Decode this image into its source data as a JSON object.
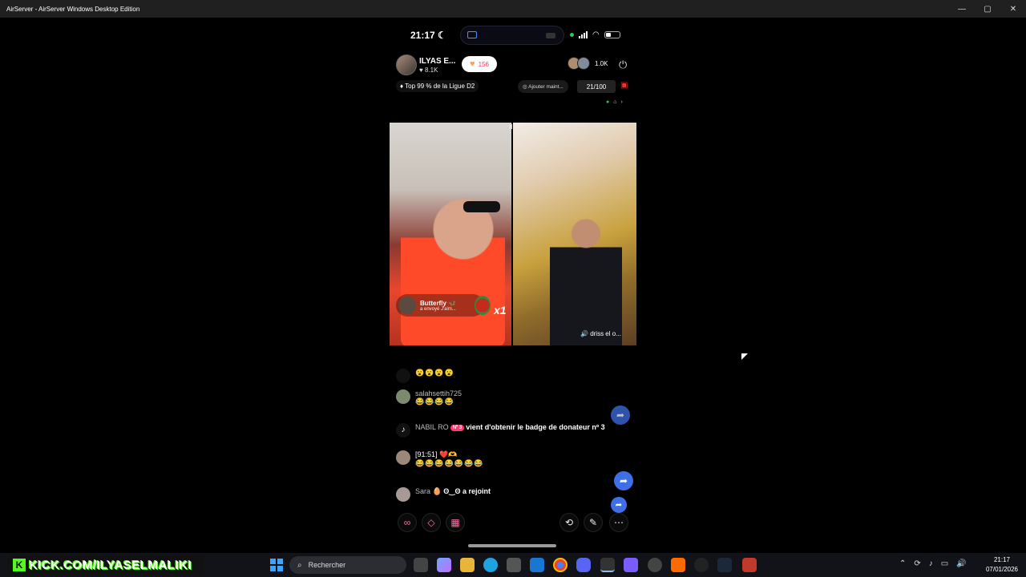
{
  "window": {
    "title": "AirServer - AirServer Windows Desktop Edition",
    "controls": [
      "minimize",
      "maximize",
      "close"
    ]
  },
  "phone": {
    "status": {
      "time": "21:17"
    },
    "host": {
      "name": "ILYAS E...",
      "likes": "8.1K",
      "follow_count": "156"
    },
    "viewers": {
      "count": "1.0K"
    },
    "rank": {
      "text": "Top 99 % de la Ligue D2"
    },
    "add_button": "Ajouter maint...",
    "goal": "21/100",
    "gift_toast": {
      "name": "Butterfly",
      "sub": "a envoyé J'aim...",
      "multiplier": "x1"
    },
    "guest": {
      "name": "driss el o..."
    },
    "chat": [
      {
        "user": "",
        "text": "",
        "emoji": "😮😮😮😮"
      },
      {
        "user": "salahsettih725",
        "text": "",
        "emoji": "😂😂😂😂"
      },
      {
        "user": "NABIL RO",
        "badge": "Nº 3",
        "text": "vient d'obtenir le badge de donateur nº 3",
        "emoji": ""
      },
      {
        "user": "[91:51]",
        "text": "",
        "emoji": "😂😂😂😂😂😂😂"
      },
      {
        "user": "Sara",
        "text": "ʘ‿ʘ a rejoint",
        "emoji": ""
      }
    ],
    "bottom_icons": [
      "link-icon",
      "multi-guest-icon",
      "apps-icon",
      "share-icon",
      "magic-wand-icon",
      "more-icon"
    ]
  },
  "taskbar": {
    "kick_banner": "KICK.COM/ILYASELMALIKI",
    "search_placeholder": "Rechercher",
    "clock_time": "21:17",
    "clock_date": "07/01/2026"
  },
  "colors": {
    "accent_blue": "#3f6fe7",
    "kick_green": "#53fc18",
    "tiktok_pink": "#ff3b5c"
  }
}
